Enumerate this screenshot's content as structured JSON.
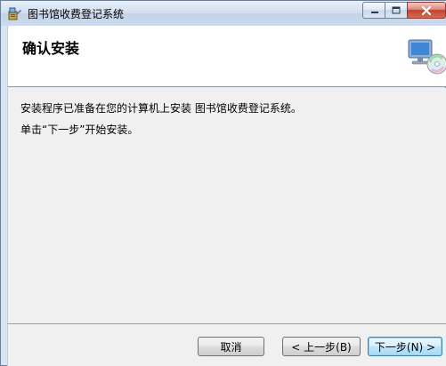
{
  "window": {
    "title": "图书馆收费登记系统",
    "icon": "installer-app-icon",
    "controls": {
      "minimize_icon": "minimize-icon",
      "maximize_icon": "maximize-icon",
      "close_icon": "close-icon"
    }
  },
  "header": {
    "title": "确认安装",
    "graphic": "computer-disc-icon"
  },
  "body": {
    "line1": "安装程序已准备在您的计算机上安装 图书馆收费登记系统。",
    "line2": "单击“下一步”开始安装。"
  },
  "buttons": {
    "cancel": "取消",
    "back": "< 上一步(B)",
    "next": "下一步(N) >"
  },
  "colors": {
    "titlebar": "#cbdaec",
    "header_bg": "#ffffff",
    "body_bg": "#f0f0f0",
    "close_button": "#c7402a",
    "default_button_border": "#3c7fb1"
  }
}
